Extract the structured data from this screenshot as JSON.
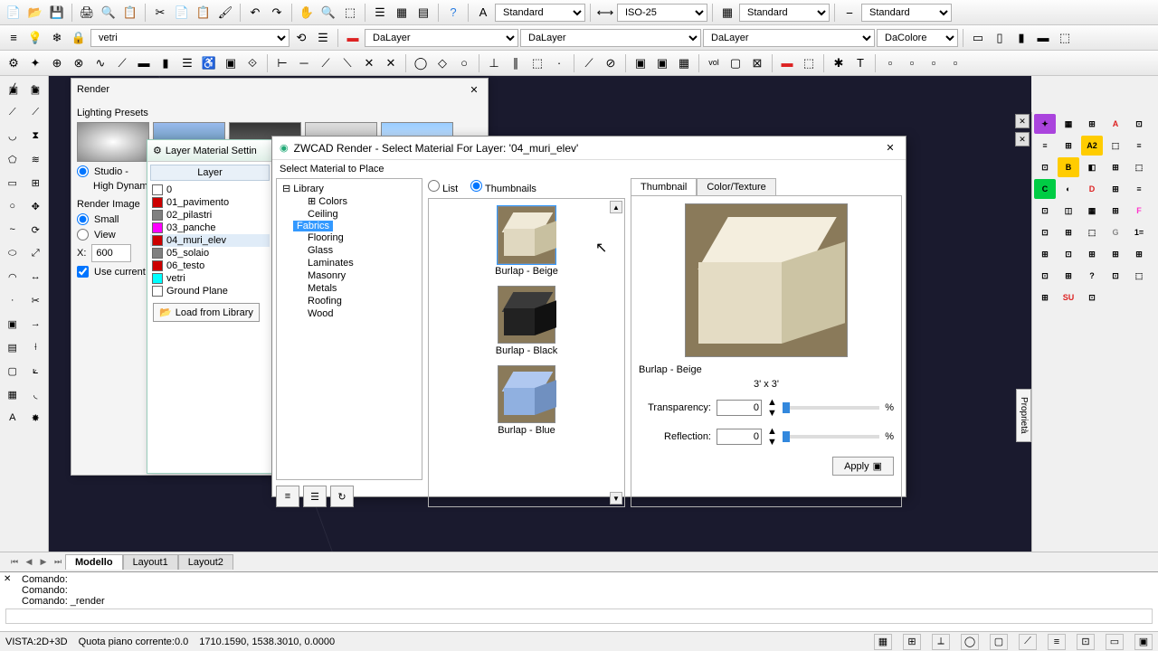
{
  "toolbar1": {
    "style1": "Standard",
    "style2": "ISO-25",
    "style3": "Standard",
    "style4": "Standard"
  },
  "toolbar2": {
    "layer_combo": "vetri",
    "lt1": "DaLayer",
    "lt2": "DaLayer",
    "lt3": "DaLayer",
    "color": "DaColore"
  },
  "tabs": {
    "t1": "Modello",
    "t2": "Layout1",
    "t3": "Layout2"
  },
  "cmd": {
    "l1": "Comando:",
    "l2": "Comando:",
    "l3": "Comando: _render"
  },
  "status": {
    "vista": "VISTA:2D+3D",
    "quota": "Quota piano corrente:0.0",
    "coords": "1710.1590, 1538.3010, 0.0000"
  },
  "renderDlg": {
    "title": "Render",
    "lighting": "Lighting Presets",
    "studio": "Studio -",
    "hdr": "High Dynami",
    "renderImage": "Render Image",
    "small": "Small",
    "view": "View",
    "xlabel": "X:",
    "xval": "600",
    "useCurrent": "Use current"
  },
  "layerMatDlg": {
    "title": "Layer Material Settin",
    "header": "Layer",
    "items": [
      {
        "name": "0",
        "color": "#ffffff"
      },
      {
        "name": "01_pavimento",
        "color": "#cc0000"
      },
      {
        "name": "02_pilastri",
        "color": "#808080"
      },
      {
        "name": "03_panche",
        "color": "#ff00ff"
      },
      {
        "name": "04_muri_elev",
        "color": "#cc0000"
      },
      {
        "name": "05_solaio",
        "color": "#808080"
      },
      {
        "name": "06_testo",
        "color": "#cc0000"
      },
      {
        "name": "vetri",
        "color": "#00ffff"
      },
      {
        "name": "Ground Plane",
        "color": "#ffffff"
      }
    ],
    "load": "Load from Library"
  },
  "matDlg": {
    "title": "ZWCAD Render - Select Material For Layer: '04_muri_elev'",
    "subtitle": "Select Material to Place",
    "tree_root": "Library",
    "tree": [
      "Colors",
      "Ceiling",
      "Fabrics",
      "Flooring",
      "Glass",
      "Laminates",
      "Masonry",
      "Metals",
      "Roofing",
      "Wood"
    ],
    "tree_selected": "Fabrics",
    "view_list": "List",
    "view_thumb": "Thumbnails",
    "thumbs": [
      {
        "name": "Burlap - Beige"
      },
      {
        "name": "Burlap - Black"
      },
      {
        "name": "Burlap - Blue"
      }
    ],
    "tabs": {
      "thumb": "Thumbnail",
      "ct": "Color/Texture"
    },
    "sel_name": "Burlap - Beige",
    "sel_dim": "3'  x  3'",
    "transp_label": "Transparency:",
    "refl_label": "Reflection:",
    "transp_val": "0",
    "refl_val": "0",
    "pct": "%",
    "apply": "Apply"
  },
  "prop_tab": "Proprietà"
}
